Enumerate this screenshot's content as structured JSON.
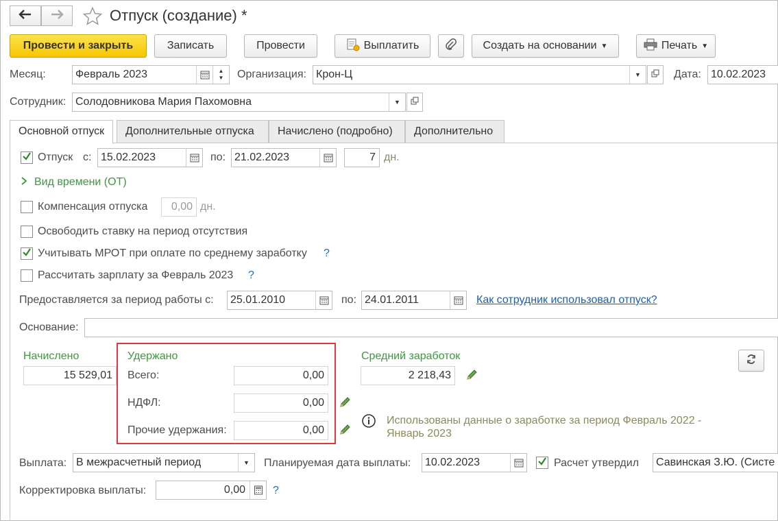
{
  "window": {
    "title": "Отпуск (создание) *"
  },
  "toolbar": {
    "post_close": "Провести и закрыть",
    "save": "Записать",
    "post": "Провести",
    "pay": "Выплатить",
    "create_based": "Создать на основании",
    "print": "Печать"
  },
  "header": {
    "month_label": "Месяц:",
    "month_value": "Февраль 2023",
    "org_label": "Организация:",
    "org_value": "Крон-Ц",
    "date_label": "Дата:",
    "date_value": "10.02.2023",
    "employee_label": "Сотрудник:",
    "employee_value": "Солодовникова Мария Пахомовна"
  },
  "tabs": [
    {
      "label": "Основной отпуск"
    },
    {
      "label": "Дополнительные отпуска"
    },
    {
      "label": "Начислено (подробно)"
    },
    {
      "label": "Дополнительно"
    }
  ],
  "vacation": {
    "label": "Отпуск",
    "from_label": "с:",
    "from_value": "15.02.2023",
    "to_label": "по:",
    "to_value": "21.02.2023",
    "days_value": "7",
    "days_unit": "дн.",
    "checked": true
  },
  "time_kind": {
    "label": "Вид времени (ОТ)"
  },
  "compensation": {
    "label": "Компенсация отпуска",
    "value": "0,00",
    "unit": "дн.",
    "checked": false
  },
  "release_rate": {
    "label": "Освободить ставку на период отсутствия",
    "checked": false
  },
  "mrot": {
    "label": "Учитывать МРОТ при оплате по среднему заработку",
    "help": "?",
    "checked": true
  },
  "calc_salary": {
    "label": "Рассчитать зарплату за Февраль 2023",
    "help": "?",
    "checked": false
  },
  "work_period": {
    "label": "Предоставляется за период работы с:",
    "from_value": "25.01.2010",
    "to_label": "по:",
    "to_value": "24.01.2011",
    "link": "Как сотрудник использовал отпуск?"
  },
  "basis": {
    "label": "Основание:",
    "value": ""
  },
  "accrued": {
    "title": "Начислено",
    "value": "15 529,01"
  },
  "withheld": {
    "title": "Удержано",
    "total_label": "Всего:",
    "total_value": "0,00",
    "ndfl_label": "НДФЛ:",
    "ndfl_value": "0,00",
    "other_label": "Прочие удержания:",
    "other_value": "0,00"
  },
  "avg_earnings": {
    "title": "Средний заработок",
    "value": "2 218,43",
    "info": "Использованы данные о заработке за период Февраль 2022 - Январь 2023"
  },
  "payment": {
    "label": "Выплата:",
    "value": "В межрасчетный период",
    "planned_label": "Планируемая дата выплаты:",
    "planned_value": "10.02.2023",
    "approved_label": "Расчет утвердил",
    "approved_checked": true,
    "approver_value": "Савинская З.Ю. (Систе",
    "correction_label": "Корректировка выплаты:",
    "correction_value": "0,00",
    "correction_help": "?"
  },
  "colors": {
    "primary_button": "#f4c700",
    "green_label": "#3c9a3c",
    "highlight": "#e0363c",
    "link": "#1a5fb4"
  }
}
